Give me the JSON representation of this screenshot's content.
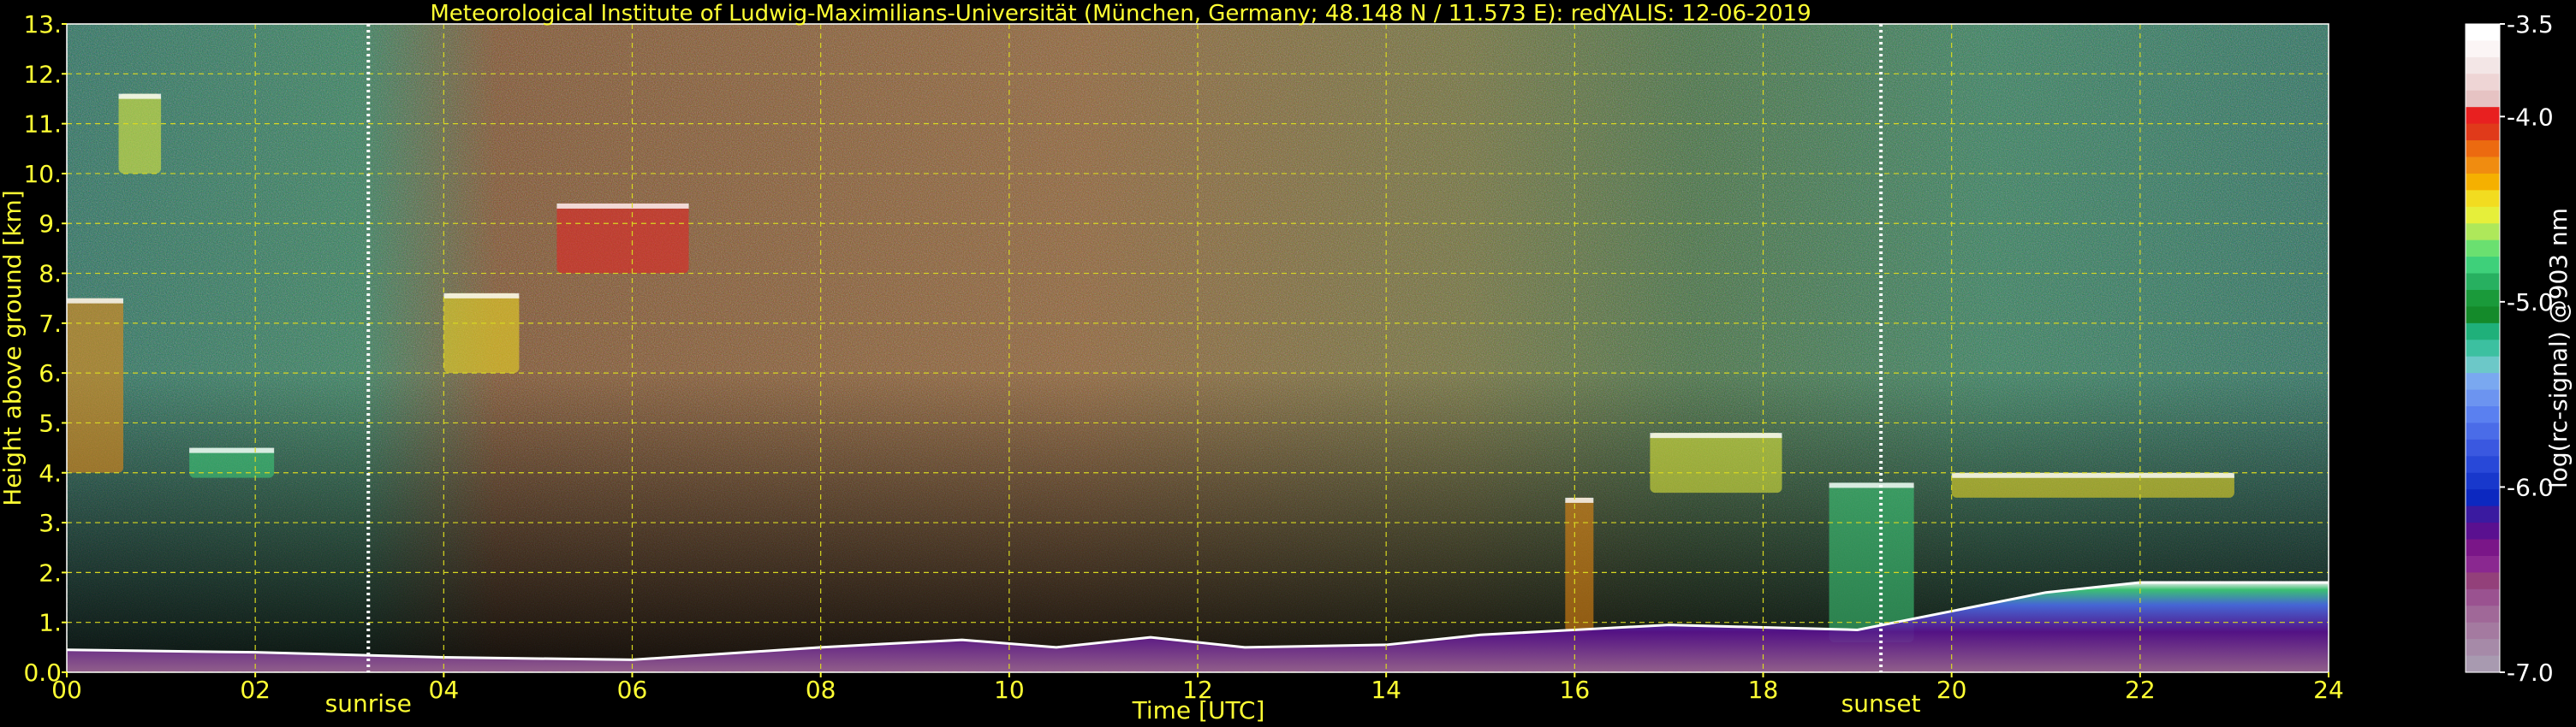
{
  "chart_data": {
    "type": "heatmap",
    "title": "Meteorological Institute of Ludwig-Maximilians-Universität (München, Germany; 48.148 N / 11.573 E):    redYALIS: 12-06-2019",
    "xlabel": "Time [UTC]",
    "ylabel": "Height above ground [km]",
    "xlim": [
      0,
      24
    ],
    "ylim": [
      0,
      13
    ],
    "x_ticks": [
      "00",
      "02",
      "04",
      "06",
      "08",
      "10",
      "12",
      "14",
      "16",
      "18",
      "20",
      "22",
      "24"
    ],
    "x_tick_values": [
      0,
      2,
      4,
      6,
      8,
      10,
      12,
      14,
      16,
      18,
      20,
      22,
      24
    ],
    "y_ticks": [
      "0.0",
      "1.",
      "2.",
      "3.",
      "4.",
      "5.",
      "6.",
      "7.",
      "8.",
      "9.",
      "10.",
      "11.",
      "12.",
      "13."
    ],
    "y_tick_values": [
      0,
      1,
      2,
      3,
      4,
      5,
      6,
      7,
      8,
      9,
      10,
      11,
      12,
      13
    ],
    "grid": true,
    "markers": [
      {
        "label": "sunrise",
        "time": 3.2
      },
      {
        "label": "sunset",
        "time": 19.25
      }
    ],
    "colorbar": {
      "label": "log(rc-signal) @903 nm",
      "ticks": [
        "-3.5",
        "-4.0",
        "-5.0",
        "-6.0",
        "-7.0"
      ],
      "tick_values": [
        -3.5,
        -4.0,
        -5.0,
        -6.0,
        -7.0
      ],
      "range": [
        -7.0,
        -3.5
      ],
      "colors": [
        "#ffffff",
        "#fbf5f5",
        "#f3e6e6",
        "#eed5d5",
        "#e6c3c3",
        "#e82020",
        "#e03a1a",
        "#ec6a10",
        "#f08c10",
        "#f5b000",
        "#f2dc20",
        "#e6ef3a",
        "#aee85a",
        "#6ae070",
        "#3ed07a",
        "#27b060",
        "#1a9a3a",
        "#148a2a",
        "#1fb07a",
        "#3cc0a0",
        "#6cc8c8",
        "#7aa8f0",
        "#6c94f0",
        "#5a80f0",
        "#4a6ce8",
        "#3a58e0",
        "#2848d8",
        "#1838cc",
        "#0c28c0",
        "#3a1aa0",
        "#5a1090",
        "#7a1688",
        "#8a2890",
        "#93407a",
        "#9a5290",
        "#a06898",
        "#a47aa0",
        "#a68aa8",
        "#a89ab0"
      ]
    },
    "layers": [
      {
        "name": "noise_sky",
        "description": "dense speckle above boundary layer"
      },
      {
        "name": "boundary_layer",
        "top_km_profile": [
          [
            0,
            0.45
          ],
          [
            2,
            0.4
          ],
          [
            3,
            0.35
          ],
          [
            4,
            0.3
          ],
          [
            6,
            0.25
          ],
          [
            8,
            0.5
          ],
          [
            9.5,
            0.65
          ],
          [
            10.5,
            0.5
          ],
          [
            11.5,
            0.7
          ],
          [
            12.5,
            0.5
          ],
          [
            14,
            0.55
          ],
          [
            15,
            0.75
          ],
          [
            16,
            0.85
          ],
          [
            17,
            0.95
          ],
          [
            18,
            0.9
          ],
          [
            19,
            0.85
          ],
          [
            21,
            1.6
          ],
          [
            22,
            1.8
          ],
          [
            24,
            1.8
          ]
        ]
      }
    ],
    "clouds": [
      {
        "t0": 0.55,
        "t1": 1.0,
        "h0": 10.0,
        "h1": 11.6
      },
      {
        "t0": 0.0,
        "t1": 0.6,
        "h0": 4.0,
        "h1": 7.5
      },
      {
        "t0": 1.3,
        "t1": 2.2,
        "h0": 3.9,
        "h1": 4.5
      },
      {
        "t0": 4.0,
        "t1": 4.8,
        "h0": 6.0,
        "h1": 7.6
      },
      {
        "t0": 5.2,
        "t1": 6.6,
        "h0": 8.0,
        "h1": 9.4
      },
      {
        "t0": 16.8,
        "t1": 18.2,
        "h0": 3.6,
        "h1": 4.8
      },
      {
        "t0": 15.9,
        "t1": 16.2,
        "h0": 0.8,
        "h1": 3.5
      },
      {
        "t0": 18.7,
        "t1": 19.6,
        "h0": 0.6,
        "h1": 3.8
      },
      {
        "t0": 20.0,
        "t1": 23.0,
        "h0": 3.5,
        "h1": 4.0
      }
    ]
  }
}
